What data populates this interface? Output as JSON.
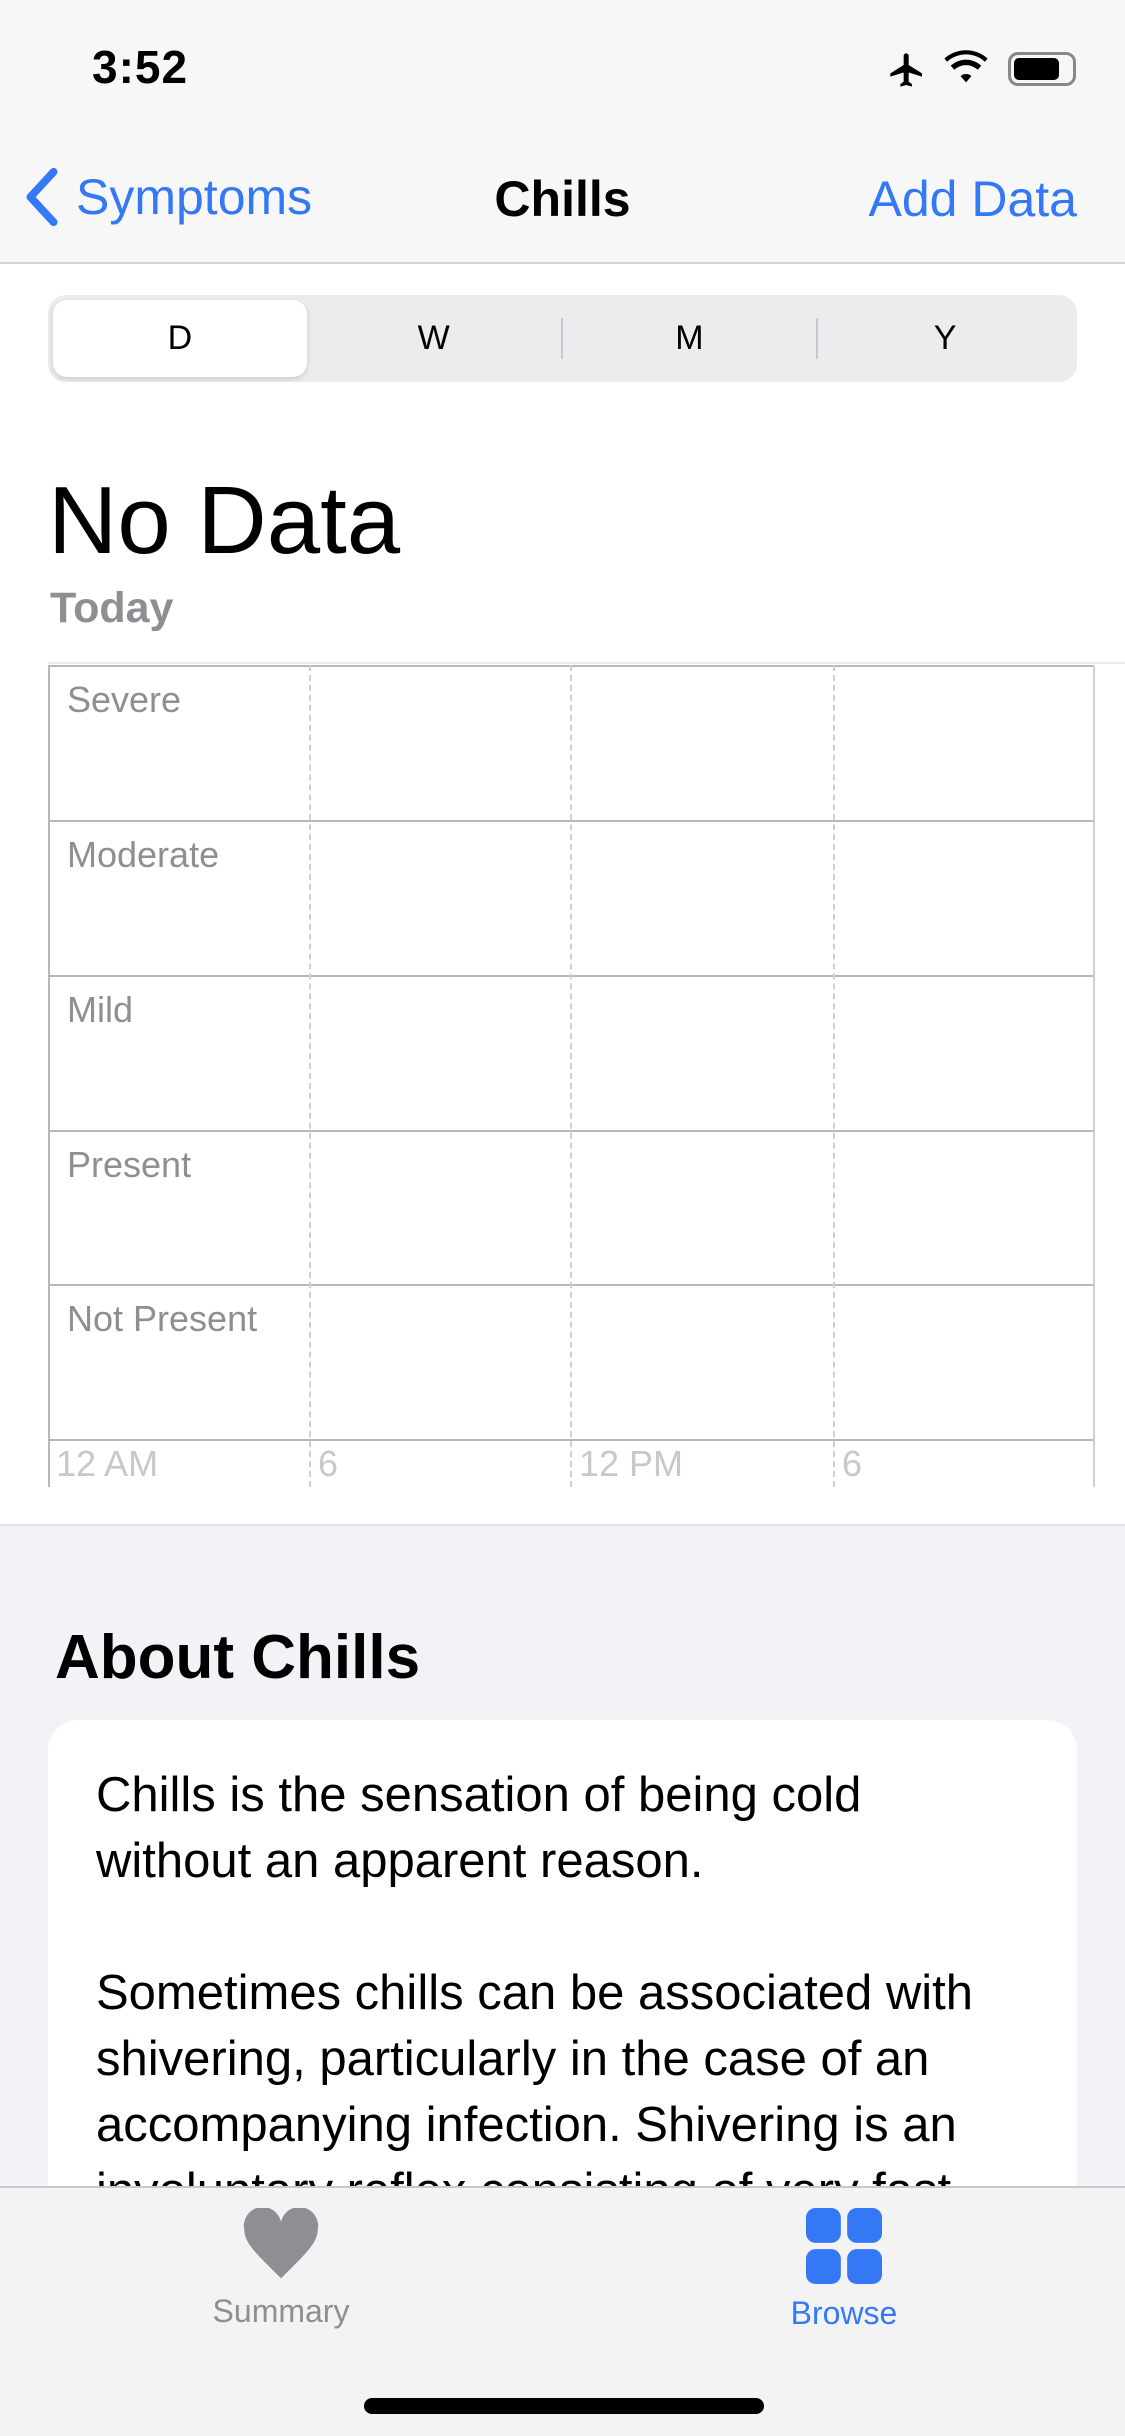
{
  "status_bar": {
    "time": "3:52",
    "icons": [
      "airplane-icon",
      "wifi-icon",
      "battery-icon"
    ]
  },
  "nav": {
    "back_label": "Symptoms",
    "title": "Chills",
    "action_label": "Add Data"
  },
  "segments": {
    "items": [
      "D",
      "W",
      "M",
      "Y"
    ],
    "selected": "D"
  },
  "summary": {
    "value": "No Data",
    "period": "Today"
  },
  "chart_data": {
    "type": "scatter",
    "y_categories": [
      "Severe",
      "Moderate",
      "Mild",
      "Present",
      "Not Present"
    ],
    "x_ticks": [
      "12 AM",
      "6",
      "12 PM",
      "6"
    ],
    "series": []
  },
  "about": {
    "heading": "About Chills",
    "paragraphs": [
      "Chills is the sensation of being cold without an apparent reason.",
      "Sometimes chills can be associated with shivering, particularly in the case of an accompanying infection. Shivering is an involuntary reflex consisting of very fast"
    ]
  },
  "tabbar": {
    "items": [
      {
        "label": "Summary",
        "icon": "heart-icon",
        "active": false
      },
      {
        "label": "Browse",
        "icon": "grid-icon",
        "active": true
      }
    ]
  },
  "colors": {
    "accent": "#3478f6",
    "inactive": "#8e8e93"
  }
}
